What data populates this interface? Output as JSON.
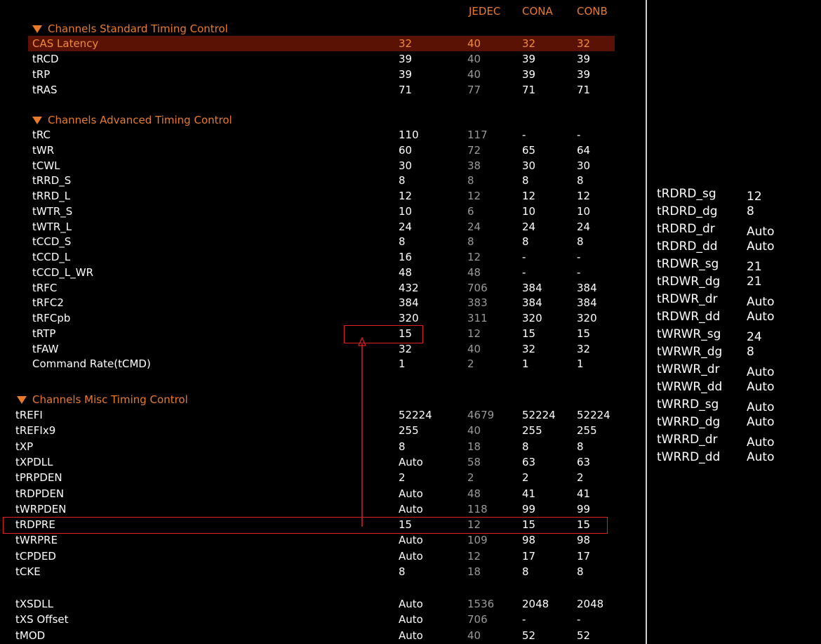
{
  "header": {
    "jedec": "JEDEC",
    "cona": "CONA",
    "conb": "CONB"
  },
  "sections": {
    "standard": "Channels Standard Timing Control",
    "advanced": "Channels Advanced Timing Control",
    "misc": "Channels Misc Timing Control"
  },
  "standard_rows": [
    {
      "label": "CAS Latency",
      "value": "32",
      "jedec": "40",
      "cona": "32",
      "conb": "32",
      "selected": true
    },
    {
      "label": "tRCD",
      "value": "39",
      "jedec": "40",
      "cona": "39",
      "conb": "39"
    },
    {
      "label": "tRP",
      "value": "39",
      "jedec": "40",
      "cona": "39",
      "conb": "39"
    },
    {
      "label": "tRAS",
      "value": "71",
      "jedec": "77",
      "cona": "71",
      "conb": "71"
    }
  ],
  "advanced_rows": [
    {
      "label": "tRC",
      "value": "110",
      "jedec": "117",
      "cona": "-",
      "conb": "-"
    },
    {
      "label": "tWR",
      "value": "60",
      "jedec": "72",
      "cona": "65",
      "conb": "64"
    },
    {
      "label": "tCWL",
      "value": "30",
      "jedec": "38",
      "cona": "30",
      "conb": "30"
    },
    {
      "label": "tRRD_S",
      "value": "8",
      "jedec": "8",
      "cona": "8",
      "conb": "8"
    },
    {
      "label": "tRRD_L",
      "value": "12",
      "jedec": "12",
      "cona": "12",
      "conb": "12"
    },
    {
      "label": "tWTR_S",
      "value": "10",
      "jedec": "6",
      "cona": "10",
      "conb": "10"
    },
    {
      "label": "tWTR_L",
      "value": "24",
      "jedec": "24",
      "cona": "24",
      "conb": "24"
    },
    {
      "label": "tCCD_S",
      "value": "8",
      "jedec": "8",
      "cona": "8",
      "conb": "8"
    },
    {
      "label": "tCCD_L",
      "value": "16",
      "jedec": "12",
      "cona": "-",
      "conb": "-"
    },
    {
      "label": "tCCD_L_WR",
      "value": "48",
      "jedec": "48",
      "cona": "-",
      "conb": "-"
    },
    {
      "label": "tRFC",
      "value": "432",
      "jedec": "706",
      "cona": "384",
      "conb": "384"
    },
    {
      "label": "tRFC2",
      "value": "384",
      "jedec": "383",
      "cona": "384",
      "conb": "384"
    },
    {
      "label": "tRFCpb",
      "value": "320",
      "jedec": "311",
      "cona": "320",
      "conb": "320"
    },
    {
      "label": "tRTP",
      "value": "15",
      "jedec": "12",
      "cona": "15",
      "conb": "15"
    },
    {
      "label": "tFAW",
      "value": "32",
      "jedec": "40",
      "cona": "32",
      "conb": "32"
    },
    {
      "label": "Command Rate(tCMD)",
      "value": "1",
      "jedec": "2",
      "cona": "1",
      "conb": "1"
    }
  ],
  "misc_rows": [
    {
      "label": "tREFI",
      "value": "52224",
      "jedec": "4679",
      "cona": "52224",
      "conb": "52224"
    },
    {
      "label": "tREFIx9",
      "value": "255",
      "jedec": "40",
      "cona": "255",
      "conb": "255"
    },
    {
      "label": "tXP",
      "value": "8",
      "jedec": "18",
      "cona": "8",
      "conb": "8"
    },
    {
      "label": "tXPDLL",
      "value": "Auto",
      "jedec": "58",
      "cona": "63",
      "conb": "63"
    },
    {
      "label": "tPRPDEN",
      "value": "2",
      "jedec": "2",
      "cona": "2",
      "conb": "2"
    },
    {
      "label": "tRDPDEN",
      "value": "Auto",
      "jedec": "48",
      "cona": "41",
      "conb": "41"
    },
    {
      "label": "tWRPDEN",
      "value": "Auto",
      "jedec": "118",
      "cona": "99",
      "conb": "99"
    },
    {
      "label": "tRDPRE",
      "value": "15",
      "jedec": "12",
      "cona": "15",
      "conb": "15"
    },
    {
      "label": "tWRPRE",
      "value": "Auto",
      "jedec": "109",
      "cona": "98",
      "conb": "98"
    },
    {
      "label": "tCPDED",
      "value": "Auto",
      "jedec": "12",
      "cona": "17",
      "conb": "17"
    },
    {
      "label": "tCKE",
      "value": "8",
      "jedec": "18",
      "cona": "8",
      "conb": "8"
    },
    {
      "label": "tXSDLL",
      "value": "Auto",
      "jedec": "1536",
      "cona": "2048",
      "conb": "2048"
    },
    {
      "label": "tXS Offset",
      "value": "Auto",
      "jedec": "706",
      "cona": "-",
      "conb": "-"
    },
    {
      "label": "tMOD",
      "value": "Auto",
      "jedec": "40",
      "cona": "52",
      "conb": "52"
    }
  ],
  "side_rows": [
    {
      "label": "tRDRD_sg",
      "value": "12"
    },
    {
      "label": "tRDRD_dg",
      "value": "8"
    },
    {
      "label": "tRDRD_dr",
      "value": "Auto"
    },
    {
      "label": "tRDRD_dd",
      "value": "Auto"
    },
    {
      "label": "tRDWR_sg",
      "value": "21"
    },
    {
      "label": "tRDWR_dg",
      "value": "21"
    },
    {
      "label": "tRDWR_dr",
      "value": "Auto"
    },
    {
      "label": "tRDWR_dd",
      "value": "Auto"
    },
    {
      "label": "tWRWR_sg",
      "value": "24"
    },
    {
      "label": "tWRWR_dg",
      "value": "8"
    },
    {
      "label": "tWRWR_dr",
      "value": "Auto"
    },
    {
      "label": "tWRWR_dd",
      "value": "Auto"
    },
    {
      "label": "tWRRD_sg",
      "value": "Auto"
    },
    {
      "label": "tWRRD_dg",
      "value": "Auto"
    },
    {
      "label": "tWRRD_dr",
      "value": "Auto"
    },
    {
      "label": "tWRRD_dd",
      "value": "Auto"
    }
  ],
  "colors": {
    "accent": "#e87a2c",
    "selected_bg": "#5a1204",
    "highlight_box": "#e02020",
    "jedec_text": "#9a9a9a"
  }
}
